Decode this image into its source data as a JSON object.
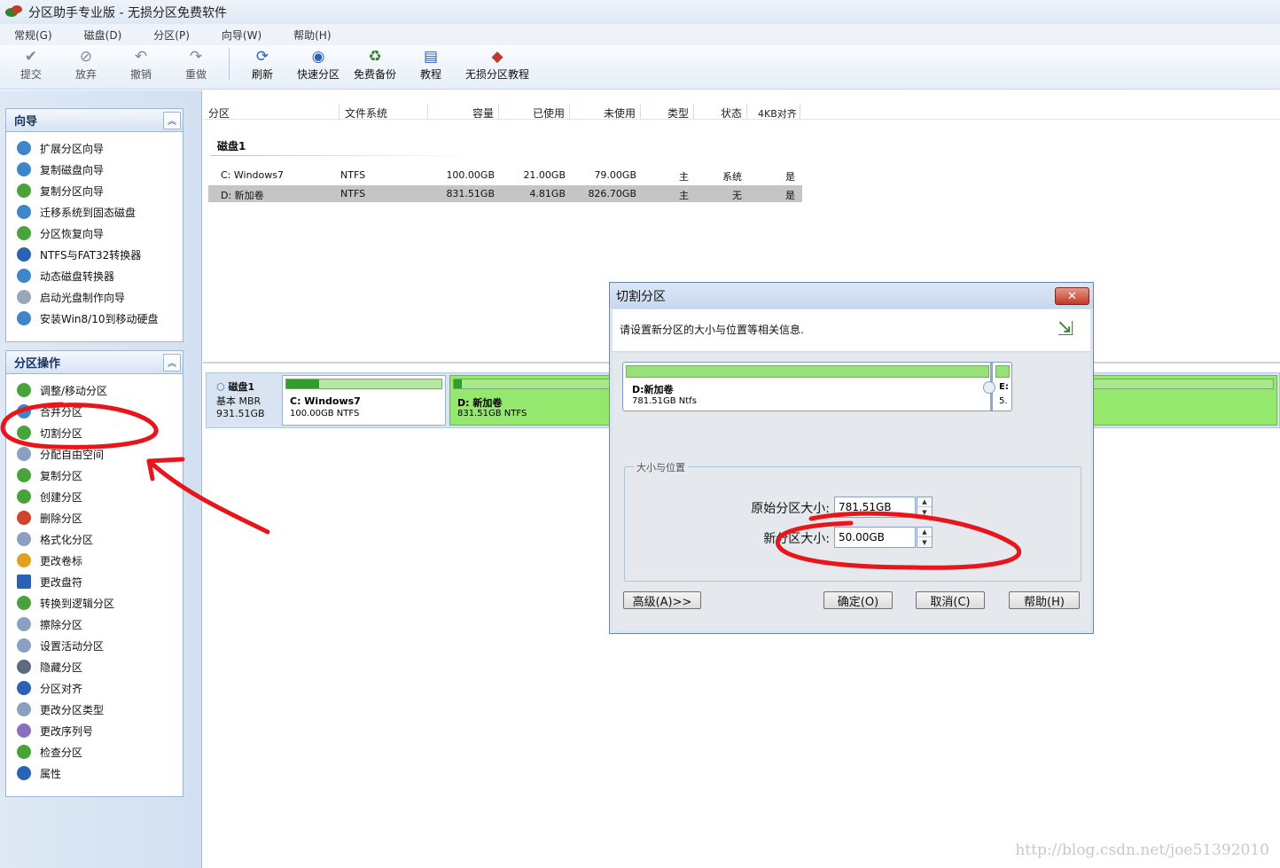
{
  "window": {
    "title": "分区助手专业版 - 无损分区免费软件"
  },
  "menu": [
    "常规(G)",
    "磁盘(D)",
    "分区(P)",
    "向导(W)",
    "帮助(H)"
  ],
  "toolbar": {
    "buttons": [
      {
        "label": "提交",
        "icon": "check-icon"
      },
      {
        "label": "放弃",
        "icon": "discard-icon"
      },
      {
        "label": "撤销",
        "icon": "undo-icon"
      },
      {
        "label": "重做",
        "icon": "redo-icon"
      },
      {
        "label": "刷新",
        "icon": "refresh-icon"
      },
      {
        "label": "快速分区",
        "icon": "quick-partition-icon"
      },
      {
        "label": "免费备份",
        "icon": "backup-icon"
      },
      {
        "label": "教程",
        "icon": "tutorial-icon"
      },
      {
        "label": "无损分区教程",
        "icon": "lossless-tutorial-icon"
      }
    ]
  },
  "wizard_panel": {
    "title": "向导",
    "items": [
      "扩展分区向导",
      "复制磁盘向导",
      "复制分区向导",
      "迁移系统到固态磁盘",
      "分区恢复向导",
      "NTFS与FAT32转换器",
      "动态磁盘转换器",
      "启动光盘制作向导",
      "安装Win8/10到移动硬盘"
    ]
  },
  "ops_panel": {
    "title": "分区操作",
    "items": [
      "调整/移动分区",
      "合并分区",
      "切割分区",
      "分配自由空间",
      "复制分区",
      "创建分区",
      "删除分区",
      "格式化分区",
      "更改卷标",
      "更改盘符",
      "转换到逻辑分区",
      "擦除分区",
      "设置活动分区",
      "隐藏分区",
      "分区对齐",
      "更改分区类型",
      "更改序列号",
      "检查分区",
      "属性"
    ]
  },
  "table": {
    "columns": [
      "分区",
      "文件系统",
      "容量",
      "已使用",
      "未使用",
      "类型",
      "状态",
      "4KB对齐"
    ],
    "disk_label": "磁盘1",
    "rows": [
      {
        "partition": "C: Windows7",
        "fs": "NTFS",
        "capacity": "100.00GB",
        "used": "21.00GB",
        "free": "79.00GB",
        "type": "主",
        "status": "系统",
        "aligned": "是"
      },
      {
        "partition": "D: 新加卷",
        "fs": "NTFS",
        "capacity": "831.51GB",
        "used": "4.81GB",
        "free": "826.70GB",
        "type": "主",
        "status": "无",
        "aligned": "是"
      }
    ]
  },
  "disk_map": {
    "disk_name": "磁盘1",
    "disk_type": "基本 MBR",
    "disk_size": "931.51GB",
    "partitions": [
      {
        "name": "C: Windows7",
        "info": "100.00GB NTFS",
        "used_fraction": 0.21
      },
      {
        "name": "D: 新加卷",
        "info": "831.51GB NTFS",
        "used_fraction": 0.006
      }
    ]
  },
  "dialog": {
    "title": "切割分区",
    "message": "请设置新分区的大小与位置等相关信息.",
    "map": {
      "part_name": "D:新加卷",
      "part_size": "781.51GB Ntfs",
      "new_name": "E:",
      "new_size": "5."
    },
    "group_label": "大小与位置",
    "fields": [
      {
        "label": "原始分区大小:",
        "value": "781.51GB"
      },
      {
        "label": "新分区大小:",
        "value": "50.00GB"
      }
    ],
    "buttons": {
      "advanced": "高级(A)>>",
      "ok": "确定(O)",
      "cancel": "取消(C)",
      "help": "帮助(H)"
    }
  },
  "watermark": "http://blog.csdn.net/joe51392010",
  "colors": {
    "accent": "#2f9e2c",
    "selection": "#93e86d",
    "annotation": "#e8151b"
  }
}
